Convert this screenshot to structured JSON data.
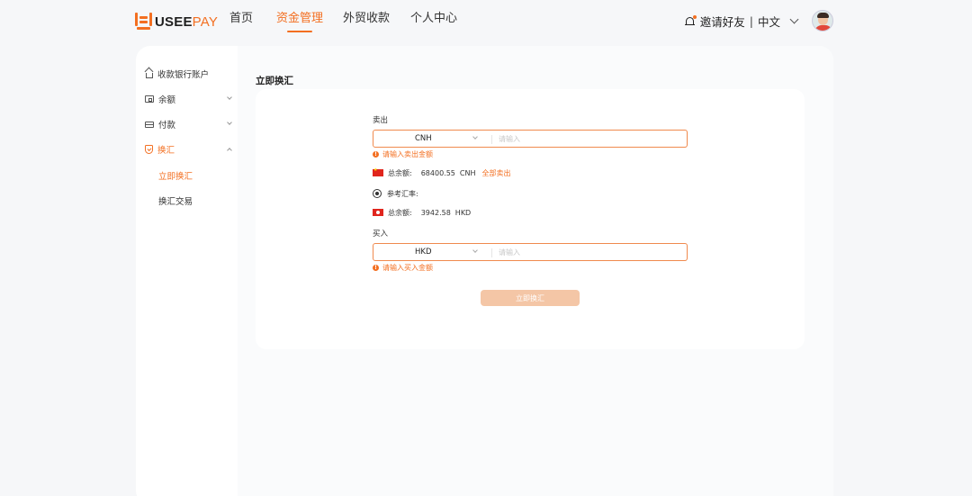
{
  "header": {
    "logo_part1": "USEE",
    "logo_part2": "PAY",
    "nav": [
      {
        "label": "首页",
        "active": false
      },
      {
        "label": "资金管理",
        "active": true
      },
      {
        "label": "外贸收款",
        "active": false
      },
      {
        "label": "个人中心",
        "active": false
      }
    ],
    "invite_label": "邀请好友",
    "separator": "|",
    "language": "中文"
  },
  "sidebar": {
    "items": [
      {
        "label": "收款银行账户",
        "icon": "home-icon"
      },
      {
        "label": "余额",
        "icon": "wallet-icon"
      },
      {
        "label": "付款",
        "icon": "card-icon"
      },
      {
        "label": "换汇",
        "icon": "shield-icon",
        "active": true
      }
    ],
    "sub_items": [
      {
        "label": "立即换汇",
        "active": true
      },
      {
        "label": "换汇交易",
        "active": false
      }
    ]
  },
  "page": {
    "title": "立即换汇",
    "sell": {
      "label": "卖出",
      "currency": "CNH",
      "amount_placeholder": "请输入",
      "error": "请输入卖出金额",
      "balance_label": "总余额:",
      "balance_value": "68400.55",
      "balance_currency": "CNH",
      "sell_all_link": "全部卖出"
    },
    "rate": {
      "label": "参考汇率:"
    },
    "buy": {
      "balance_label": "总余额:",
      "balance_value": "3942.58",
      "balance_currency": "HKD",
      "label": "买入",
      "currency": "HKD",
      "amount_placeholder": "请输入",
      "error": "请输入买入金额"
    },
    "submit_label": "立即换汇"
  },
  "colors": {
    "accent": "#f36f21",
    "submit_disabled": "#f4c6a6"
  }
}
